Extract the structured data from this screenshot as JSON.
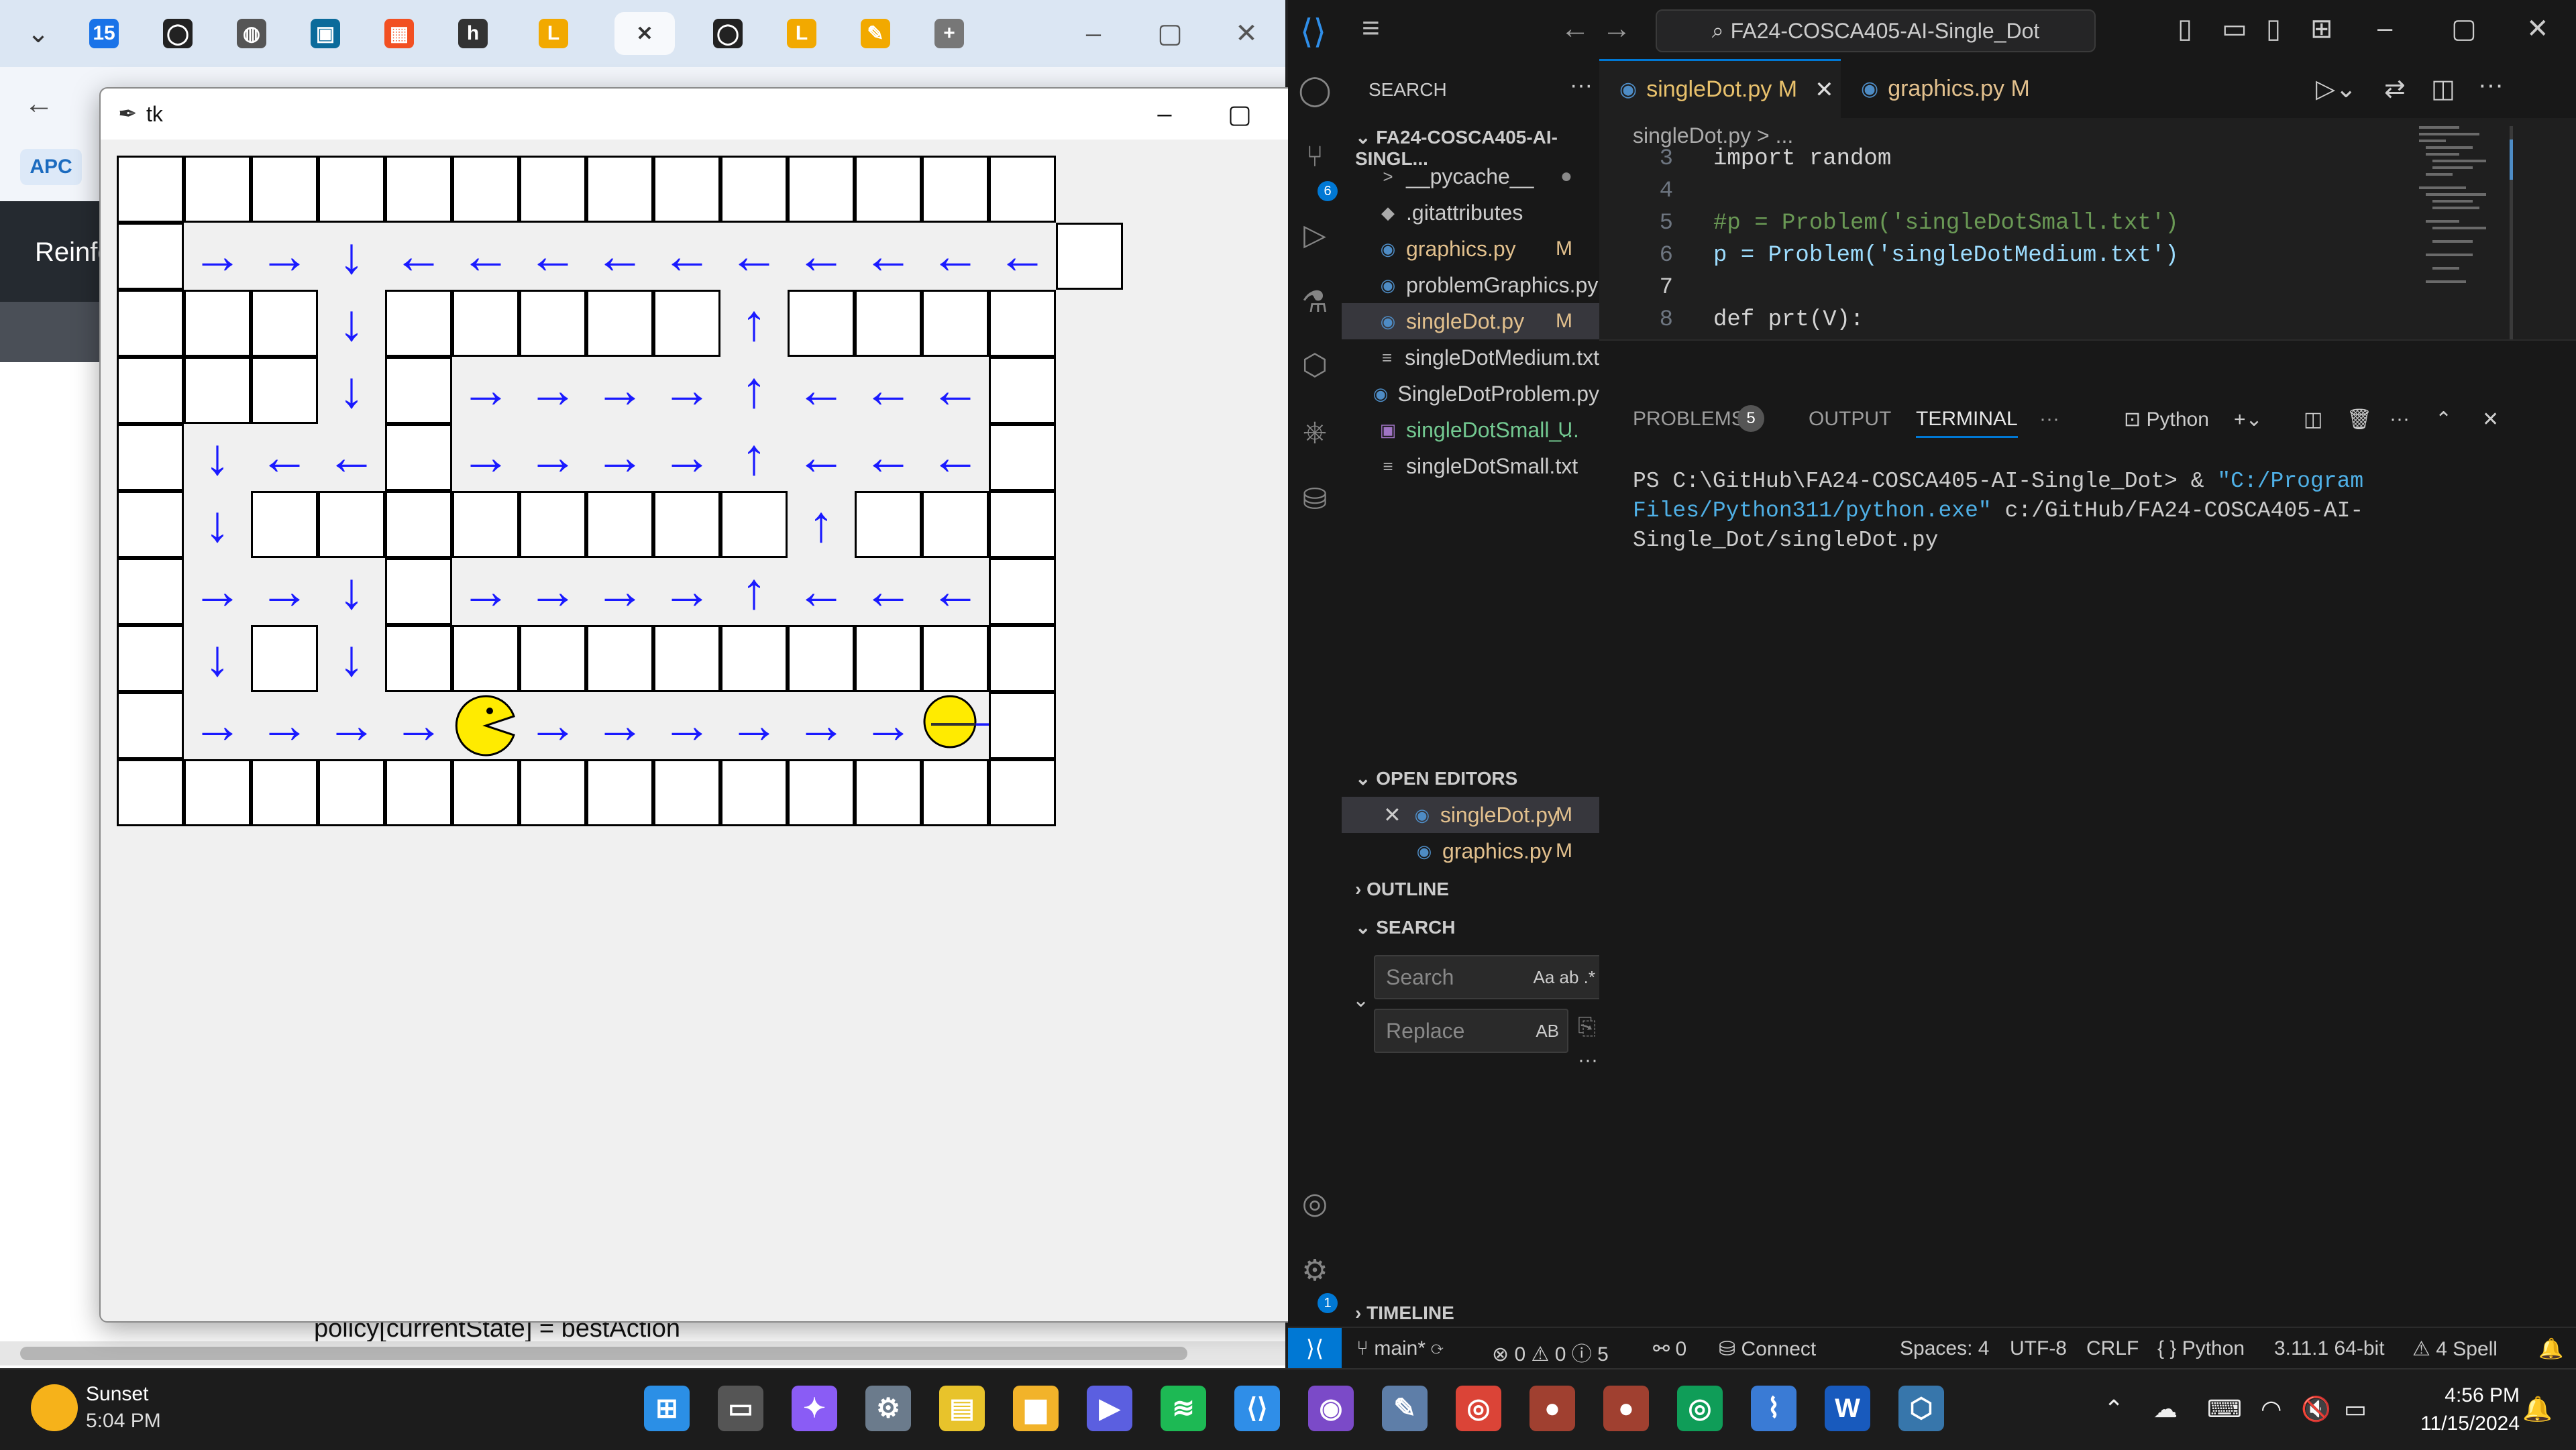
{
  "browser": {
    "tabs": [
      {
        "icon": "calendar-icon",
        "label": "15",
        "color": "#1a73e8"
      },
      {
        "icon": "github-icon",
        "label": "◯",
        "color": "#222222"
      },
      {
        "icon": "globe-icon",
        "label": "◍",
        "color": "#555555"
      },
      {
        "icon": "app-icon",
        "label": "▣",
        "color": "#0b6b9b"
      },
      {
        "icon": "microsoft-icon",
        "label": "▦",
        "color": "#f25022"
      },
      {
        "icon": "h-icon",
        "label": "h",
        "color": "#333333"
      },
      {
        "icon": "l-icon",
        "label": "L",
        "color": "#f2a900"
      },
      {
        "icon": "close-icon",
        "label": "✕",
        "color": "#333333"
      },
      {
        "icon": "github-icon",
        "label": "◯",
        "color": "#222222"
      },
      {
        "icon": "l-icon",
        "label": "L",
        "color": "#f2a900"
      },
      {
        "icon": "pen-icon",
        "label": "✎",
        "color": "#f2a900"
      },
      {
        "icon": "new-tab-icon",
        "label": "+",
        "color": "#777777"
      }
    ],
    "bookmark_label": "APC",
    "page_heading": "Reinfo",
    "code_fragment": "policy[currentState] = bestAction"
  },
  "tk_window": {
    "title": "tk",
    "maze": {
      "rows": [
        "##############",
        "#rrdllllllllll#",
        "###d#####u####",
        "###d#rrrrulll#",
        "#dll#rrrrulll#",
        "#d########u###",
        "#rrd#rrrrulll#",
        "#d#d##########",
        "#rrrrPrrrrrrS#",
        "##############"
      ]
    }
  },
  "vscode": {
    "search_box": "FA24-COSCA405-AI-Single_Dot",
    "sidebar": {
      "header": "SEARCH",
      "folder": "FA24-COSCA405-AI-SINGL...",
      "files": [
        {
          "name": "__pycache__",
          "icon": ">",
          "status": "●",
          "color": "#cccccc"
        },
        {
          "name": ".gitattributes",
          "icon": "◆",
          "status": "",
          "color": "#cccccc"
        },
        {
          "name": "graphics.py",
          "icon": "◉",
          "status": "M",
          "color": "#e2c08d"
        },
        {
          "name": "problemGraphics.py",
          "icon": "◉",
          "status": "",
          "color": "#cccccc"
        },
        {
          "name": "singleDot.py",
          "icon": "◉",
          "status": "M",
          "color": "#e2c08d"
        },
        {
          "name": "singleDotMedium.txt",
          "icon": "≡",
          "status": "",
          "color": "#cccccc"
        },
        {
          "name": "SingleDotProblem.py",
          "icon": "◉",
          "status": "",
          "color": "#cccccc"
        },
        {
          "name": "singleDotSmall_...",
          "icon": "▣",
          "status": "U",
          "color": "#73c991"
        },
        {
          "name": "singleDotSmall.txt",
          "icon": "≡",
          "status": "",
          "color": "#cccccc"
        }
      ],
      "open_editors_header": "OPEN EDITORS",
      "open_editors": [
        {
          "name": "singleDot.py",
          "status": "M"
        },
        {
          "name": "graphics.py",
          "status": "M"
        }
      ],
      "outline_header": "OUTLINE",
      "search_header": "SEARCH",
      "search_placeholder": "Search",
      "replace_placeholder": "Replace",
      "search_opts": "Aa  ab  .*",
      "replace_opts": "AB",
      "timeline_header": "TIMELINE"
    },
    "tabs": [
      {
        "label": "singleDot.py",
        "status": "M"
      },
      {
        "label": "graphics.py",
        "status": "M"
      }
    ],
    "breadcrumb": "singleDot.py > ...",
    "code_lines": [
      {
        "n": "3",
        "text": "import random"
      },
      {
        "n": "4",
        "text": ""
      },
      {
        "n": "5",
        "text": "#p = Problem('singleDotSmall.txt')"
      },
      {
        "n": "6",
        "text": "p = Problem('singleDotMedium.txt')"
      },
      {
        "n": "7",
        "text": ""
      },
      {
        "n": "8",
        "text": "def prt(V):"
      }
    ],
    "panel": {
      "tabs": [
        "PROBLEMS",
        "OUTPUT",
        "TERMINAL"
      ],
      "problems_count": "5",
      "shell": "Python",
      "prompt": "PS C:\\GitHub\\FA24-COSCA405-AI-Single_Dot> & ",
      "exe": "\"C:/Program Files/Python311/python.exe\"",
      "script": " c:/GitHub/FA24-COSCA405-AI-Single_Dot/singleDot.py"
    },
    "status": {
      "branch": "main*",
      "errors": "⊗ 0 ⚠ 0 ⓘ 5",
      "ports": "⚯ 0",
      "connect": "Connect",
      "spaces": "Spaces: 4",
      "encoding": "UTF-8",
      "eol": "CRLF",
      "lang": "{ } Python",
      "interp": "3.11.1 64-bit",
      "spell": "⚠ 4 Spell"
    }
  },
  "taskbar": {
    "weather_label": "Sunset",
    "weather_time": "5:04 PM",
    "time": "4:56 PM",
    "date": "11/15/2024",
    "apps": [
      {
        "name": "start-icon",
        "label": "⊞",
        "color": "#2b8fe6"
      },
      {
        "name": "task-view-icon",
        "label": "▭",
        "color": "#555555"
      },
      {
        "name": "copilot-icon",
        "label": "✦",
        "color": "#8a5cf5"
      },
      {
        "name": "settings-icon",
        "label": "⚙",
        "color": "#6b7b8c"
      },
      {
        "name": "sticky-notes-icon",
        "label": "▤",
        "color": "#e8c32b"
      },
      {
        "name": "file-explorer-icon",
        "label": "▆",
        "color": "#f2b32a"
      },
      {
        "name": "media-icon",
        "label": "▶",
        "color": "#5b5fe0"
      },
      {
        "name": "spotify-icon",
        "label": "≋",
        "color": "#1db954"
      },
      {
        "name": "vscode-icon",
        "label": "⟨⟩",
        "color": "#2f8ee8"
      },
      {
        "name": "github-desktop-icon",
        "label": "◉",
        "color": "#7b4ac8"
      },
      {
        "name": "notepad-icon",
        "label": "✎",
        "color": "#5e7ea8"
      },
      {
        "name": "chrome-icon",
        "label": "◎",
        "color": "#db4437"
      },
      {
        "name": "app-icon-1",
        "label": "●",
        "color": "#a04030"
      },
      {
        "name": "app-icon-2",
        "label": "●",
        "color": "#a04030"
      },
      {
        "name": "chrome-icon-2",
        "label": "◎",
        "color": "#0f9d58"
      },
      {
        "name": "resource-monitor-icon",
        "label": "⌇",
        "color": "#3a7bd5"
      },
      {
        "name": "word-icon",
        "label": "W",
        "color": "#185abd"
      },
      {
        "name": "python-icon",
        "label": "⬡",
        "color": "#3776ab"
      }
    ]
  }
}
